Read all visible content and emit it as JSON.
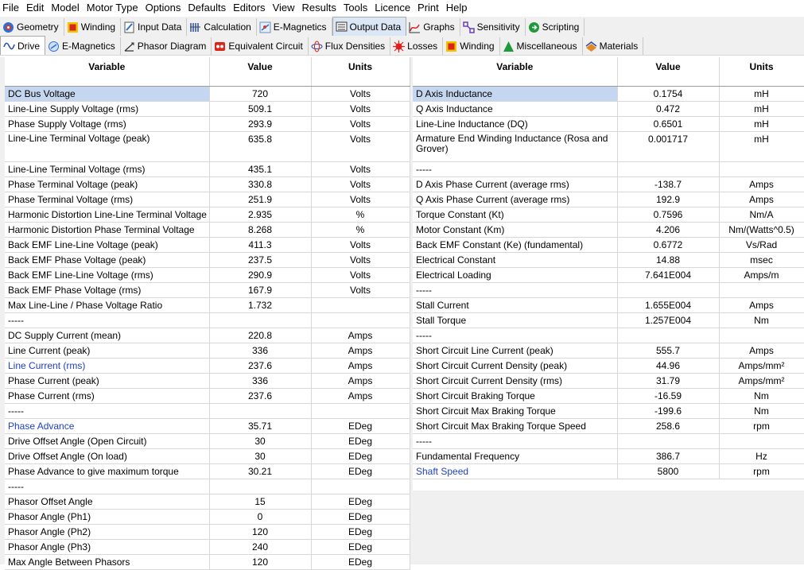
{
  "menu": [
    "File",
    "Edit",
    "Model",
    "Motor Type",
    "Options",
    "Defaults",
    "Editors",
    "View",
    "Results",
    "Tools",
    "Licence",
    "Print",
    "Help"
  ],
  "tabs_top": [
    {
      "label": "Geometry",
      "icon": "geometry-icon"
    },
    {
      "label": "Winding",
      "icon": "winding-icon"
    },
    {
      "label": "Input Data",
      "icon": "input-data-icon"
    },
    {
      "label": "Calculation",
      "icon": "calculation-icon"
    },
    {
      "label": "E-Magnetics",
      "icon": "e-magnetics-icon"
    },
    {
      "label": "Output Data",
      "icon": "output-data-icon"
    },
    {
      "label": "Graphs",
      "icon": "graphs-icon"
    },
    {
      "label": "Sensitivity",
      "icon": "sensitivity-icon"
    },
    {
      "label": "Scripting",
      "icon": "scripting-icon"
    }
  ],
  "tabs_sub": [
    {
      "label": "Drive",
      "icon": "drive-icon"
    },
    {
      "label": "E-Magnetics",
      "icon": "e-magnetics-sub-icon"
    },
    {
      "label": "Phasor Diagram",
      "icon": "phasor-icon"
    },
    {
      "label": "Equivalent Circuit",
      "icon": "equivalent-circuit-icon"
    },
    {
      "label": "Flux Densities",
      "icon": "flux-icon"
    },
    {
      "label": "Losses",
      "icon": "losses-icon"
    },
    {
      "label": "Winding",
      "icon": "winding-sub-icon"
    },
    {
      "label": "Miscellaneous",
      "icon": "miscellaneous-icon"
    },
    {
      "label": "Materials",
      "icon": "materials-icon"
    }
  ],
  "columns": {
    "variable": "Variable",
    "value": "Value",
    "units": "Units"
  },
  "left_rows": [
    {
      "variable": "DC Bus Voltage",
      "value": "720",
      "units": "Volts"
    },
    {
      "variable": "Line-Line Supply Voltage (rms)",
      "value": "509.1",
      "units": "Volts"
    },
    {
      "variable": "Phase Supply Voltage (rms)",
      "value": "293.9",
      "units": "Volts"
    },
    {
      "variable": "Line-Line Terminal Voltage (peak)",
      "value": "635.8",
      "units": "Volts",
      "tall": true
    },
    {
      "variable": "Line-Line Terminal Voltage (rms)",
      "value": "435.1",
      "units": "Volts"
    },
    {
      "variable": "Phase Terminal Voltage (peak)",
      "value": "330.8",
      "units": "Volts"
    },
    {
      "variable": "Phase Terminal Voltage (rms)",
      "value": "251.9",
      "units": "Volts"
    },
    {
      "variable": "Harmonic Distortion Line-Line Terminal Voltage",
      "value": "2.935",
      "units": "%"
    },
    {
      "variable": "Harmonic Distortion Phase Terminal Voltage",
      "value": "8.268",
      "units": "%"
    },
    {
      "variable": "Back EMF Line-Line Voltage (peak)",
      "value": "411.3",
      "units": "Volts"
    },
    {
      "variable": "Back EMF Phase Voltage (peak)",
      "value": "237.5",
      "units": "Volts"
    },
    {
      "variable": "Back EMF Line-Line Voltage (rms)",
      "value": "290.9",
      "units": "Volts"
    },
    {
      "variable": "Back EMF Phase Voltage (rms)",
      "value": "167.9",
      "units": "Volts"
    },
    {
      "variable": "Max Line-Line / Phase Voltage Ratio",
      "value": "1.732",
      "units": ""
    },
    {
      "variable": "-----",
      "value": "",
      "units": ""
    },
    {
      "variable": "DC Supply Current (mean)",
      "value": "220.8",
      "units": "Amps"
    },
    {
      "variable": "Line Current (peak)",
      "value": "336",
      "units": "Amps"
    },
    {
      "variable": "Line Current (rms)",
      "value": "237.6",
      "units": "Amps",
      "link": true
    },
    {
      "variable": "Phase Current (peak)",
      "value": "336",
      "units": "Amps"
    },
    {
      "variable": "Phase Current (rms)",
      "value": "237.6",
      "units": "Amps"
    },
    {
      "variable": "-----",
      "value": "",
      "units": ""
    },
    {
      "variable": "Phase Advance",
      "value": "35.71",
      "units": "EDeg",
      "link": true
    },
    {
      "variable": "Drive Offset Angle (Open Circuit)",
      "value": "30",
      "units": "EDeg"
    },
    {
      "variable": "Drive Offset Angle (On load)",
      "value": "30",
      "units": "EDeg"
    },
    {
      "variable": "Phase Advance to give maximum torque",
      "value": "30.21",
      "units": "EDeg"
    },
    {
      "variable": "-----",
      "value": "",
      "units": ""
    },
    {
      "variable": "Phasor Offset Angle",
      "value": "15",
      "units": "EDeg"
    },
    {
      "variable": "Phasor Angle (Ph1)",
      "value": "0",
      "units": "EDeg"
    },
    {
      "variable": "Phasor Angle (Ph2)",
      "value": "120",
      "units": "EDeg"
    },
    {
      "variable": "Phasor Angle (Ph3)",
      "value": "240",
      "units": "EDeg"
    },
    {
      "variable": "Max Angle Between Phasors",
      "value": "120",
      "units": "EDeg"
    }
  ],
  "right_rows": [
    {
      "variable": "D Axis Inductance",
      "value": "0.1754",
      "units": "mH"
    },
    {
      "variable": "Q Axis Inductance",
      "value": "0.472",
      "units": "mH"
    },
    {
      "variable": "Line-Line Inductance (DQ)",
      "value": "0.6501",
      "units": "mH"
    },
    {
      "variable": "Armature End Winding Inductance (Rosa and Grover)",
      "value": "0.001717",
      "units": "mH",
      "tall": true
    },
    {
      "variable": "-----",
      "value": "",
      "units": ""
    },
    {
      "variable": "D Axis Phase Current (average rms)",
      "value": "-138.7",
      "units": "Amps"
    },
    {
      "variable": "Q Axis Phase Current (average rms)",
      "value": "192.9",
      "units": "Amps"
    },
    {
      "variable": "Torque Constant (Kt)",
      "value": "0.7596",
      "units": "Nm/A"
    },
    {
      "variable": "Motor Constant (Km)",
      "value": "4.206",
      "units": "Nm/(Watts^0.5)"
    },
    {
      "variable": "Back EMF Constant (Ke) (fundamental)",
      "value": "0.6772",
      "units": "Vs/Rad"
    },
    {
      "variable": "Electrical Constant",
      "value": "14.88",
      "units": "msec"
    },
    {
      "variable": "Electrical Loading",
      "value": "7.641E004",
      "units": "Amps/m"
    },
    {
      "variable": "-----",
      "value": "",
      "units": ""
    },
    {
      "variable": "Stall Current",
      "value": "1.655E004",
      "units": "Amps"
    },
    {
      "variable": "Stall Torque",
      "value": "1.257E004",
      "units": "Nm"
    },
    {
      "variable": "-----",
      "value": "",
      "units": ""
    },
    {
      "variable": "Short Circuit Line Current (peak)",
      "value": "555.7",
      "units": "Amps"
    },
    {
      "variable": "Short Circuit Current Density (peak)",
      "value": "44.96",
      "units": "Amps/mm²"
    },
    {
      "variable": "Short Circuit Current Density (rms)",
      "value": "31.79",
      "units": "Amps/mm²"
    },
    {
      "variable": "Short Circuit Braking Torque",
      "value": "-16.59",
      "units": "Nm"
    },
    {
      "variable": "Short Circuit Max Braking Torque",
      "value": "-199.6",
      "units": "Nm"
    },
    {
      "variable": "Short Circuit Max Braking Torque Speed",
      "value": "258.6",
      "units": "rpm"
    },
    {
      "variable": "-----",
      "value": "",
      "units": ""
    },
    {
      "variable": "Fundamental Frequency",
      "value": "386.7",
      "units": "Hz"
    },
    {
      "variable": "Shaft Speed",
      "value": "5800",
      "units": "rpm",
      "link": true
    }
  ]
}
